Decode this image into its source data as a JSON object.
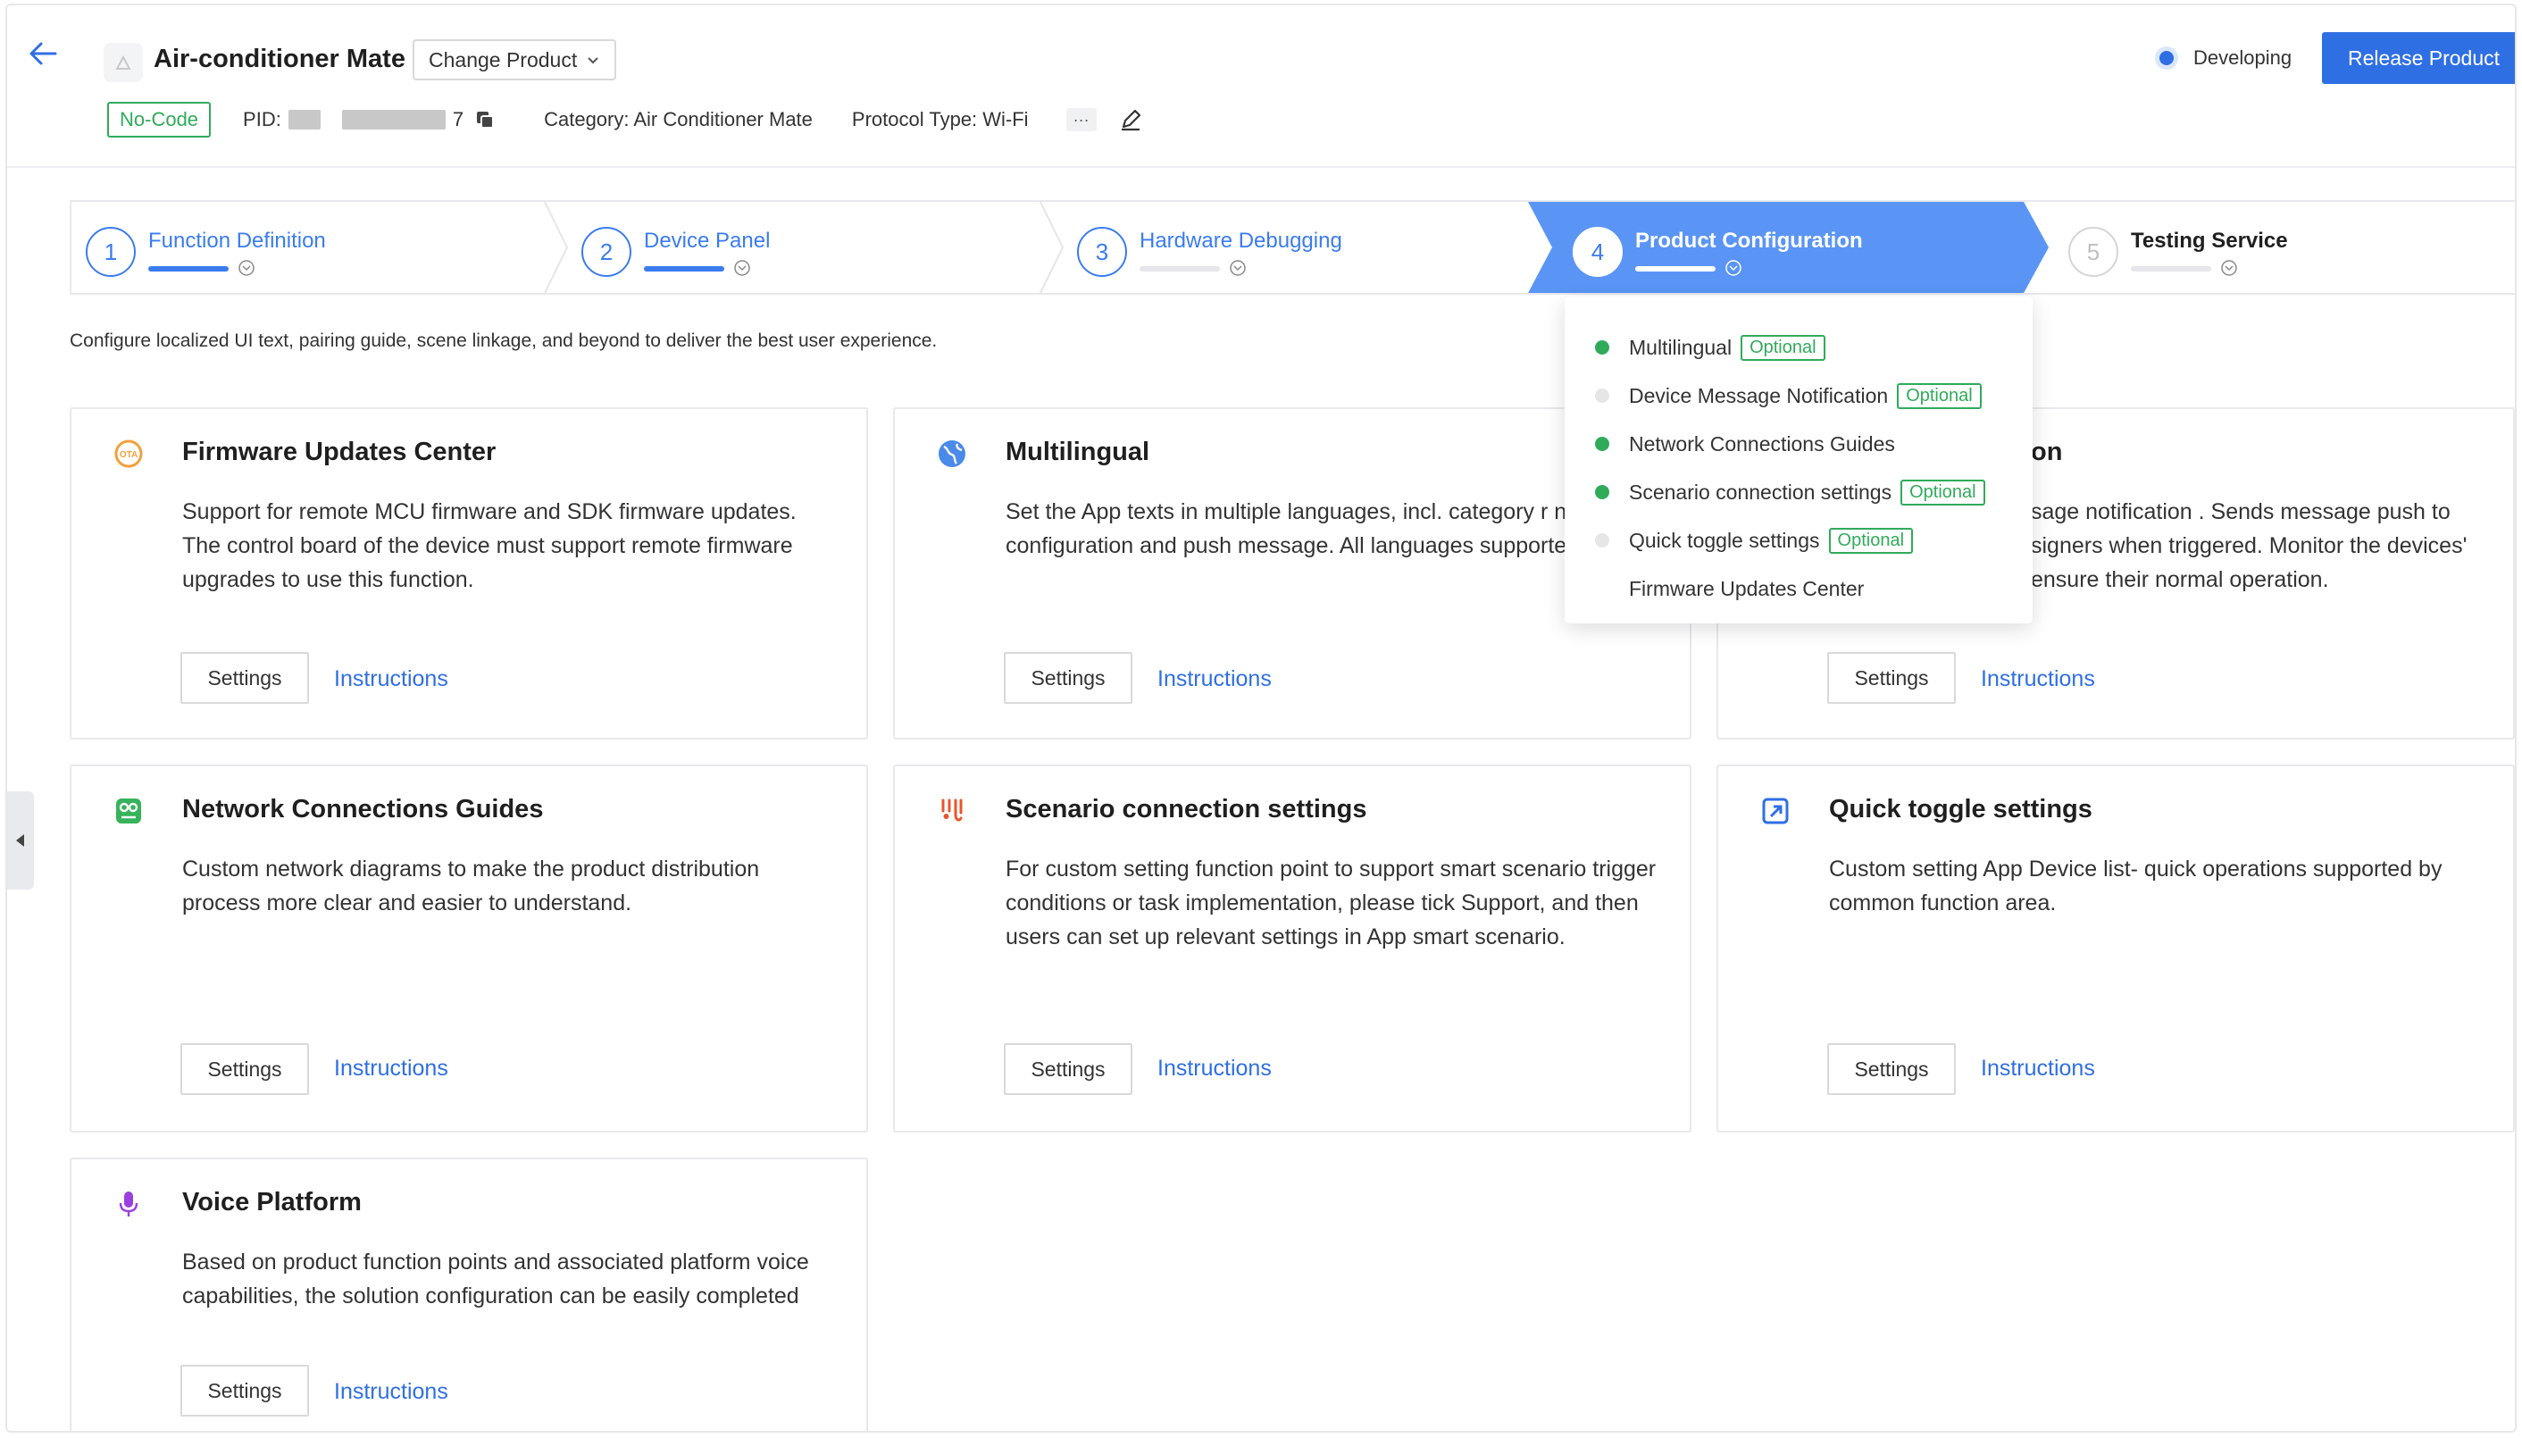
{
  "header": {
    "product_name": "Air-conditioner Mate",
    "change_product_label": "Change Product",
    "status_label": "Developing",
    "release_label": "Release Product",
    "no_code_label": "No-Code",
    "pid_label": "PID:",
    "pid_tail": "7",
    "category": "Category: Air Conditioner Mate",
    "protocol": "Protocol Type: Wi-Fi",
    "more_label": "···"
  },
  "steps": [
    {
      "num": "1",
      "title": "Function Definition",
      "state": "done"
    },
    {
      "num": "2",
      "title": "Device Panel",
      "state": "done"
    },
    {
      "num": "3",
      "title": "Hardware Debugging",
      "state": "partial"
    },
    {
      "num": "4",
      "title": "Product Configuration",
      "state": "active"
    },
    {
      "num": "5",
      "title": "Testing Service",
      "state": "todo"
    }
  ],
  "subtitle": "Configure localized UI text, pairing guide, scene linkage, and beyond to deliver the best user experience.",
  "cards": [
    {
      "title": "Firmware Updates Center",
      "icon": "ota-icon",
      "desc": "Support for remote MCU firmware and SDK firmware updates. The control board of the device must support remote firmware upgrades to use this function.",
      "settings": "Settings",
      "instructions": "Instructions"
    },
    {
      "title": "Multilingual",
      "icon": "globe-icon",
      "desc": "Set the App texts in multiple languages, incl. category r network configuration and push message. All languages supported.",
      "settings": "Settings",
      "instructions": "Instructions"
    },
    {
      "title": "on",
      "icon": "bell-icon",
      "desc": "sage notification . Sends message push to signers when triggered. Monitor the devices' ensure their normal operation.",
      "settings": "Settings",
      "instructions": "Instructions"
    },
    {
      "title": "Network Connections Guides",
      "icon": "network-guide-icon",
      "desc": "Custom network diagrams to make the product distribution process more clear and easier to understand.",
      "settings": "Settings",
      "instructions": "Instructions"
    },
    {
      "title": "Scenario connection settings",
      "icon": "scenario-icon",
      "desc": "For custom setting function point to support smart scenario trigger conditions or task implementation, please tick Support, and then users can set up relevant settings in App smart scenario.",
      "settings": "Settings",
      "instructions": "Instructions"
    },
    {
      "title": "Quick toggle settings",
      "icon": "quick-toggle-icon",
      "desc": "Custom setting App Device list- quick operations supported by common function area.",
      "settings": "Settings",
      "instructions": "Instructions"
    },
    {
      "title": "Voice Platform",
      "icon": "microphone-icon",
      "desc": "Based on product function points and associated platform voice capabilities, the solution configuration can be easily completed",
      "settings": "Settings",
      "instructions": "Instructions"
    }
  ],
  "dropdown": {
    "optional_label": "Optional",
    "items": [
      {
        "label": "Multilingual",
        "status": "done",
        "optional": true
      },
      {
        "label": "Device Message Notification",
        "status": "todo",
        "optional": true
      },
      {
        "label": "Network Connections Guides",
        "status": "done",
        "optional": false
      },
      {
        "label": "Scenario connection settings",
        "status": "done",
        "optional": true
      },
      {
        "label": "Quick toggle settings",
        "status": "todo",
        "optional": true
      },
      {
        "label": "Firmware Updates Center",
        "status": "none",
        "optional": false
      }
    ]
  },
  "colors": {
    "primary": "#2f6fe4",
    "step_active": "#5a95f5",
    "success": "#2fab5a"
  }
}
